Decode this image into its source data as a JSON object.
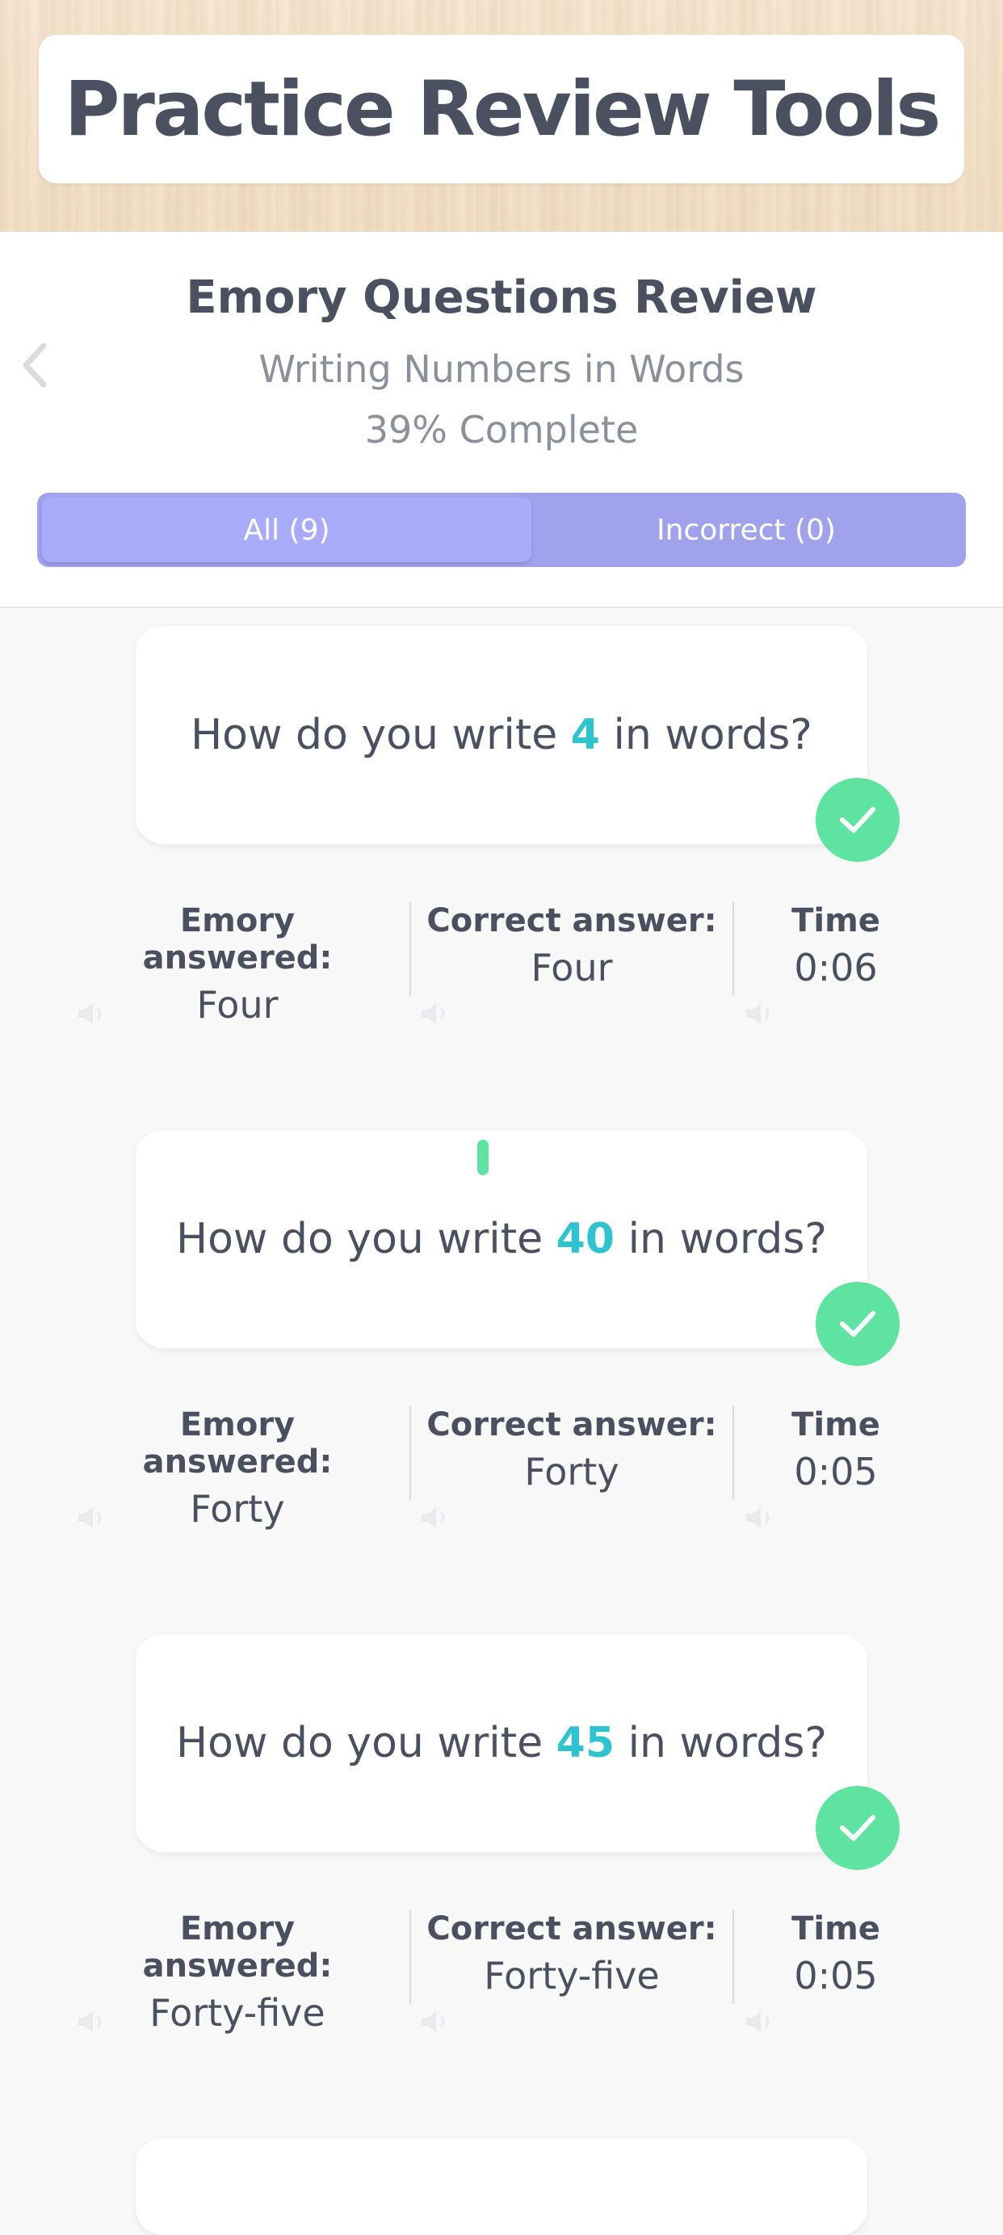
{
  "header": {
    "title": "Practice Review Tools"
  },
  "review": {
    "title": "Emory Questions Review",
    "subtitle": "Writing Numbers in Words",
    "progress": "39% Complete"
  },
  "tabs": {
    "all": "All (9)",
    "incorrect": "Incorrect (0)"
  },
  "labels": {
    "answered": "Emory answered:",
    "correct": "Correct answer:",
    "time": "Time"
  },
  "questions": [
    {
      "prefix": "How do you write",
      "number": "4",
      "suffix": "in words?",
      "answered": "Four",
      "correct": "Four",
      "time": "0:06",
      "status": "correct"
    },
    {
      "prefix": "How do you write",
      "number": "40",
      "suffix": "in words?",
      "answered": "Forty",
      "correct": "Forty",
      "time": "0:05",
      "status": "correct"
    },
    {
      "prefix": "How do you write",
      "number": "45",
      "suffix": "in words?",
      "answered": "Forty-five",
      "correct": "Forty-five",
      "time": "0:05",
      "status": "correct"
    }
  ],
  "colors": {
    "accent": "#2ec4cf",
    "success": "#5fe3a0",
    "tab": "#a0a3ec",
    "tab_active": "#a8abfa"
  },
  "icons": {
    "back": "chevron-left-icon",
    "status": "checkmark-icon",
    "audio": "speaker-icon"
  }
}
